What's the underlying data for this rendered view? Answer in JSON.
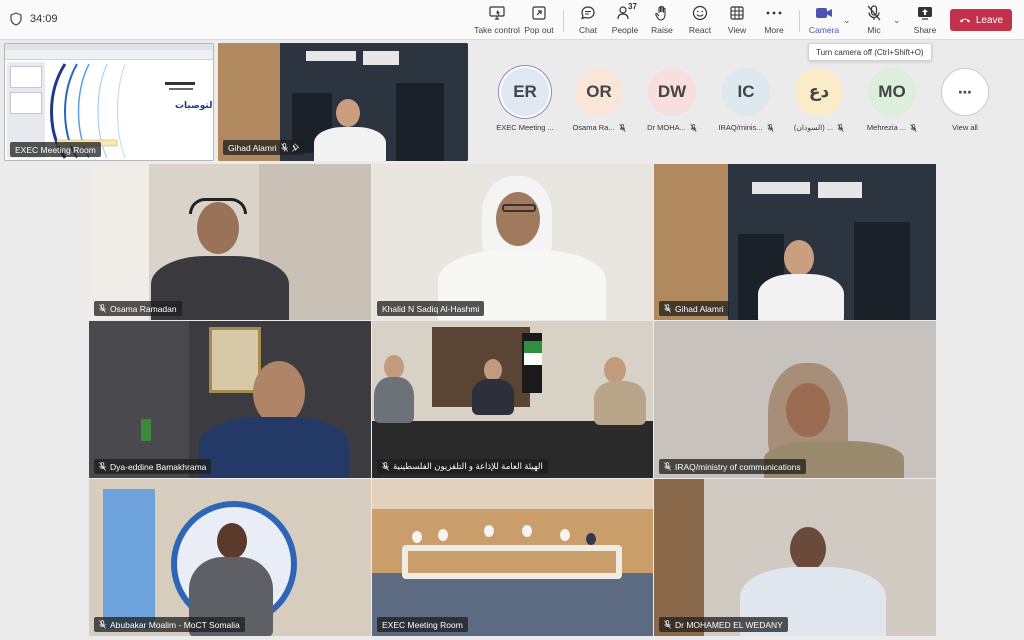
{
  "timer": "34:09",
  "toolbar": {
    "take_control": "Take control",
    "pop_out": "Pop out",
    "chat": "Chat",
    "people": "People",
    "people_count": "37",
    "raise": "Raise",
    "react": "React",
    "view": "View",
    "more": "More",
    "camera": "Camera",
    "mic": "Mic",
    "share": "Share",
    "leave": "Leave"
  },
  "tooltip": "Turn camera off (Ctrl+Shift+O)",
  "strip": {
    "shared_label": "EXEC Meeting Room",
    "gihad_label": "Gihad Alamri"
  },
  "avatars": [
    {
      "initials": "ER",
      "name": "EXEC Meeting ...",
      "bg": "#dfe8f3"
    },
    {
      "initials": "OR",
      "name": "Osama Ra...",
      "bg": "#f9e6d9"
    },
    {
      "initials": "DW",
      "name": "Dr MOHA...",
      "bg": "#f9dede"
    },
    {
      "initials": "IC",
      "name": "IRAQ/minis...",
      "bg": "#dde9ef"
    },
    {
      "initials": "دع",
      "name": "(السودان) ...",
      "bg": "#fbecc9"
    },
    {
      "initials": "MO",
      "name": "Mehrezia ...",
      "bg": "#dcefdc"
    }
  ],
  "view_all": "View all",
  "tiles": [
    {
      "name": "Osama Ramadan"
    },
    {
      "name": "Khalid N Sadiq Al-Hashmi"
    },
    {
      "name": "Gihad Alamri"
    },
    {
      "name": "Dya-eddine Bamakhrama"
    },
    {
      "name": "الهيئة العامة للإذاعة و التلفزيون الفلسطينية"
    },
    {
      "name": "IRAQ/ministry of communications"
    },
    {
      "name": "Abubakar Moalim - MoCT Somalia"
    },
    {
      "name": "EXEC Meeting Room"
    },
    {
      "name": "Dr MOHAMED EL WEDANY"
    }
  ],
  "shared_doc": {
    "heading": "التوصيات"
  },
  "colors": {
    "accent": "#4f52b2",
    "leave": "#c4314b"
  }
}
